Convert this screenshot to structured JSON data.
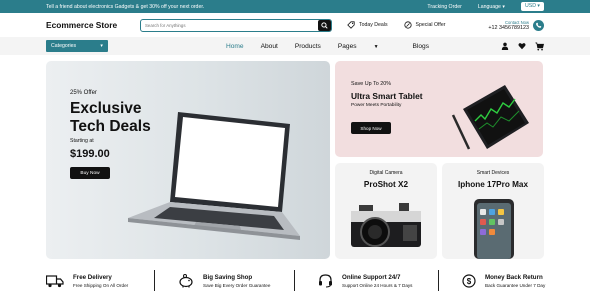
{
  "topbar": {
    "promo": "Tell a friend about electronics Gadgets & get 30% off your next order.",
    "tracking": "Tracking Order",
    "language": "Language",
    "currency": "USD"
  },
  "header": {
    "logo": "Ecommerce Store",
    "search_placeholder": "Search for Anythings",
    "today_deals": "Today Deals",
    "special_offer": "Special Offer",
    "contact_label": "Contact Now",
    "contact_number": "+12 3456789123"
  },
  "nav": {
    "categories": "Categories",
    "items": [
      "Home",
      "About",
      "Products",
      "Pages",
      "Blogs"
    ]
  },
  "hero": {
    "offer": "25% Offer",
    "title": "Exclusive Tech Deals",
    "starting": "Starting at",
    "price": "$199.00",
    "button": "Buy Now"
  },
  "tablet_promo": {
    "save": "Save Up To 20%",
    "title": "Ultra Smart Tablet",
    "subtitle": "Power Meets Portability",
    "button": "Shop Now"
  },
  "cards": [
    {
      "category": "Digital Camera",
      "name": "ProShot X2"
    },
    {
      "category": "Smart Devices",
      "name": "Iphone 17Pro Max"
    }
  ],
  "features": [
    {
      "title": "Free Delivery",
      "sub": "Free Shipping On All Order"
    },
    {
      "title": "Big Saving Shop",
      "sub": "Save Big Every Order Guarantee"
    },
    {
      "title": "Online Support 24/7",
      "sub": "Support Online 24 Hours & 7 Days"
    },
    {
      "title": "Money Back Return",
      "sub": "Back Guarantee Under 7 Day"
    }
  ],
  "colors": {
    "accent": "#2b7d8b",
    "dark": "#111111"
  }
}
